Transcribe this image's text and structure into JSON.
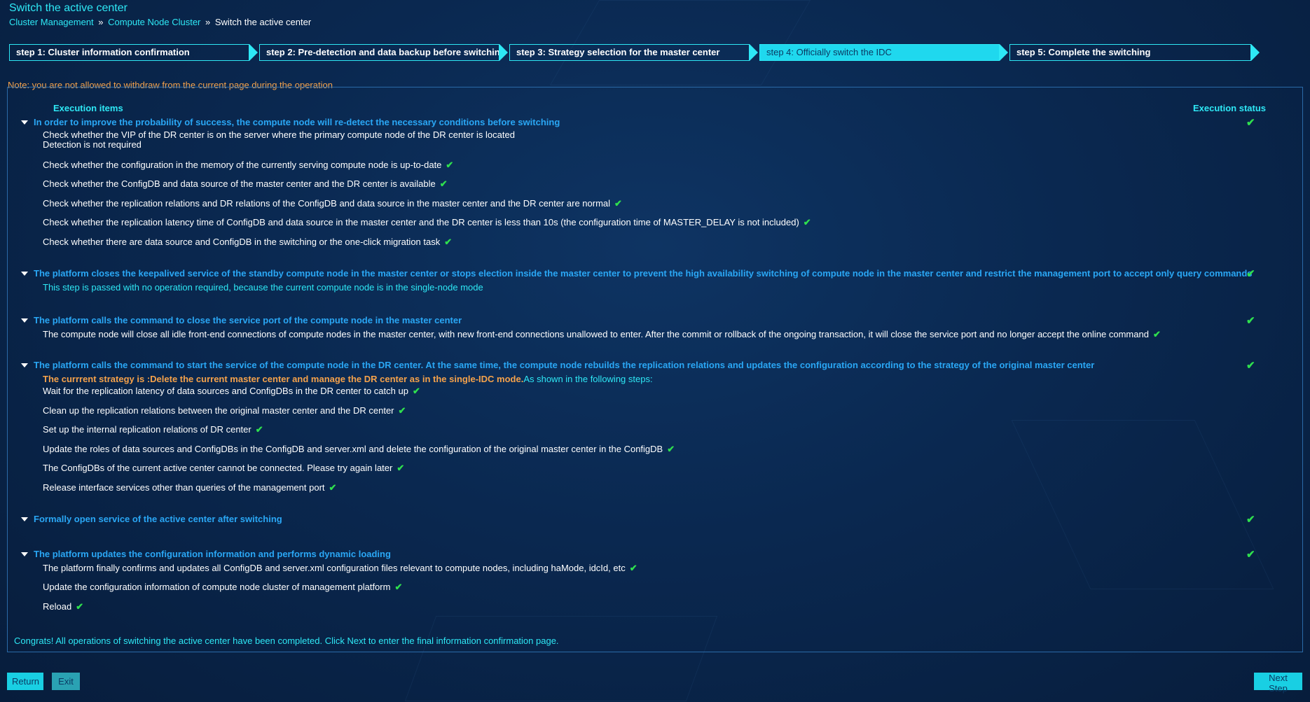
{
  "page_title": "Switch the active center",
  "breadcrumb": {
    "items": [
      "Cluster Management",
      "Compute Node Cluster"
    ],
    "separator": "»",
    "current": "Switch the active center"
  },
  "steps": [
    "step 1: Cluster information confirmation",
    "step 2: Pre-detection and data backup before switching",
    "step 3: Strategy selection for the master center",
    "step 4: Officially switch the IDC",
    "step 5: Complete the switching"
  ],
  "active_step_index": 3,
  "note": "Note: you are not allowed to withdraw from the current page during the operation",
  "columns": {
    "items": "Execution items",
    "status": "Execution status"
  },
  "sections": [
    {
      "title": "In order to improve the probability of success, the compute node will re-detect the necessary conditions before switching",
      "items": [
        "Check whether the VIP of the DR center is on the server where the primary compute node of the DR center is located",
        "Detection is not required",
        "Check whether the configuration in the memory of the currently serving compute node is up-to-date",
        "Check whether the ConfigDB and data source of the master center and the DR center is available",
        "Check whether the replication relations and DR relations of the ConfigDB and data source in the master center and the DR center are normal",
        "Check whether the replication latency time of ConfigDB and data source in the master center and the DR center is less than 10s (the configuration time of MASTER_DELAY is not included)",
        "Check whether there are data source and ConfigDB in the switching or the one-click migration task"
      ]
    },
    {
      "title": "The platform closes the keepalived service of the standby compute node in the master center or stops election inside the master center to prevent the high availability switching of compute node in the master center and restrict the management port to accept only query commands",
      "items": [
        "This step is passed with no operation required, because the current compute node is in the single-node mode"
      ]
    },
    {
      "title": "The platform calls the command to close the service port of the compute node in the master center",
      "items": [
        "The compute node will close all idle front-end connections of compute nodes in the master center, with new front-end connections unallowed to enter. After the commit or rollback of the ongoing transaction, it will close the service port and no longer accept the online command"
      ]
    },
    {
      "title": "The platform calls the command to start the service of the compute node in the DR center. At the same time, the compute node rebuilds the replication relations and updates the configuration according to the strategy of the original master center",
      "strategy_prefix": "The currrent strategy is :Delete the current master center and manage the DR center as in the single-IDC mode.",
      "strategy_suffix": "As shown in the following steps:",
      "items": [
        "Wait for the replication latency of data sources and ConfigDBs in the DR center to catch up",
        "Clean up the replication relations between the original master center and the DR center",
        "Set up the internal replication relations of DR center",
        "Update the roles of data sources and ConfigDBs in the ConfigDB and server.xml and delete the configuration of the original master center in the ConfigDB",
        "The ConfigDBs of the current active center cannot be connected. Please try again later",
        "Release interface services other than queries of the management port"
      ]
    },
    {
      "title": "Formally open service of the active center after switching",
      "items": []
    },
    {
      "title": "The platform updates the configuration information and performs dynamic loading",
      "items": [
        "The platform finally confirms and updates all ConfigDB and server.xml configuration files relevant to compute nodes, including haMode, idcId, etc",
        "Update the configuration information of compute node cluster of management platform",
        "Reload"
      ]
    }
  ],
  "check_glyph": "✔",
  "congrats": "Congrats! All operations of switching the active center have been completed. Click Next to enter the final information confirmation page.",
  "buttons": {
    "return": "Return",
    "exit": "Exit",
    "next": "Next Step"
  },
  "colors": {
    "accent": "#2ee8f5",
    "section": "#2aa7f5",
    "note": "#f5a24b",
    "check": "#2fe04e",
    "background": "#0a2850"
  }
}
